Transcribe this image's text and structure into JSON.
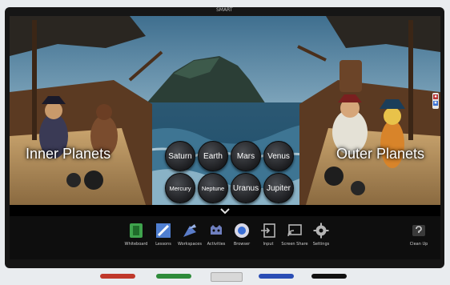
{
  "brand": "SMART",
  "scene": {
    "left_title": "Inner Planets",
    "right_title": "Outer Planets",
    "planets_row1": [
      "Saturn",
      "Earth",
      "Mars",
      "Venus"
    ],
    "planets_row2": [
      "Mercury",
      "Neptune",
      "Uranus",
      "Jupiter"
    ]
  },
  "dock": {
    "tools": [
      {
        "label": "Whiteboard",
        "icon": "whiteboard-icon",
        "color": "#3fa34d"
      },
      {
        "label": "Lessons",
        "icon": "lessons-icon",
        "color": "#4f7fd1"
      },
      {
        "label": "Workspaces",
        "icon": "workspaces-icon",
        "color": "#5a7cc8"
      },
      {
        "label": "Activities",
        "icon": "activities-icon",
        "color": "#6f7fbf"
      },
      {
        "label": "Browser",
        "icon": "browser-icon",
        "color": "#3b6fd6"
      },
      {
        "label": "Input",
        "icon": "input-icon",
        "color": "#b5b5b5"
      },
      {
        "label": "Screen Share",
        "icon": "screen-share-icon",
        "color": "#b5b5b5"
      },
      {
        "label": "Settings",
        "icon": "settings-icon",
        "color": "#b5b5b5"
      }
    ],
    "clean_up_label": "Clean Up"
  },
  "pen_tray": {
    "pens": [
      {
        "name": "red-pen",
        "color": "#c0392b"
      },
      {
        "name": "green-pen",
        "color": "#2e8b3a"
      },
      {
        "name": "blue-pen",
        "color": "#2a4db5"
      },
      {
        "name": "black-pen",
        "color": "#111111"
      }
    ]
  }
}
